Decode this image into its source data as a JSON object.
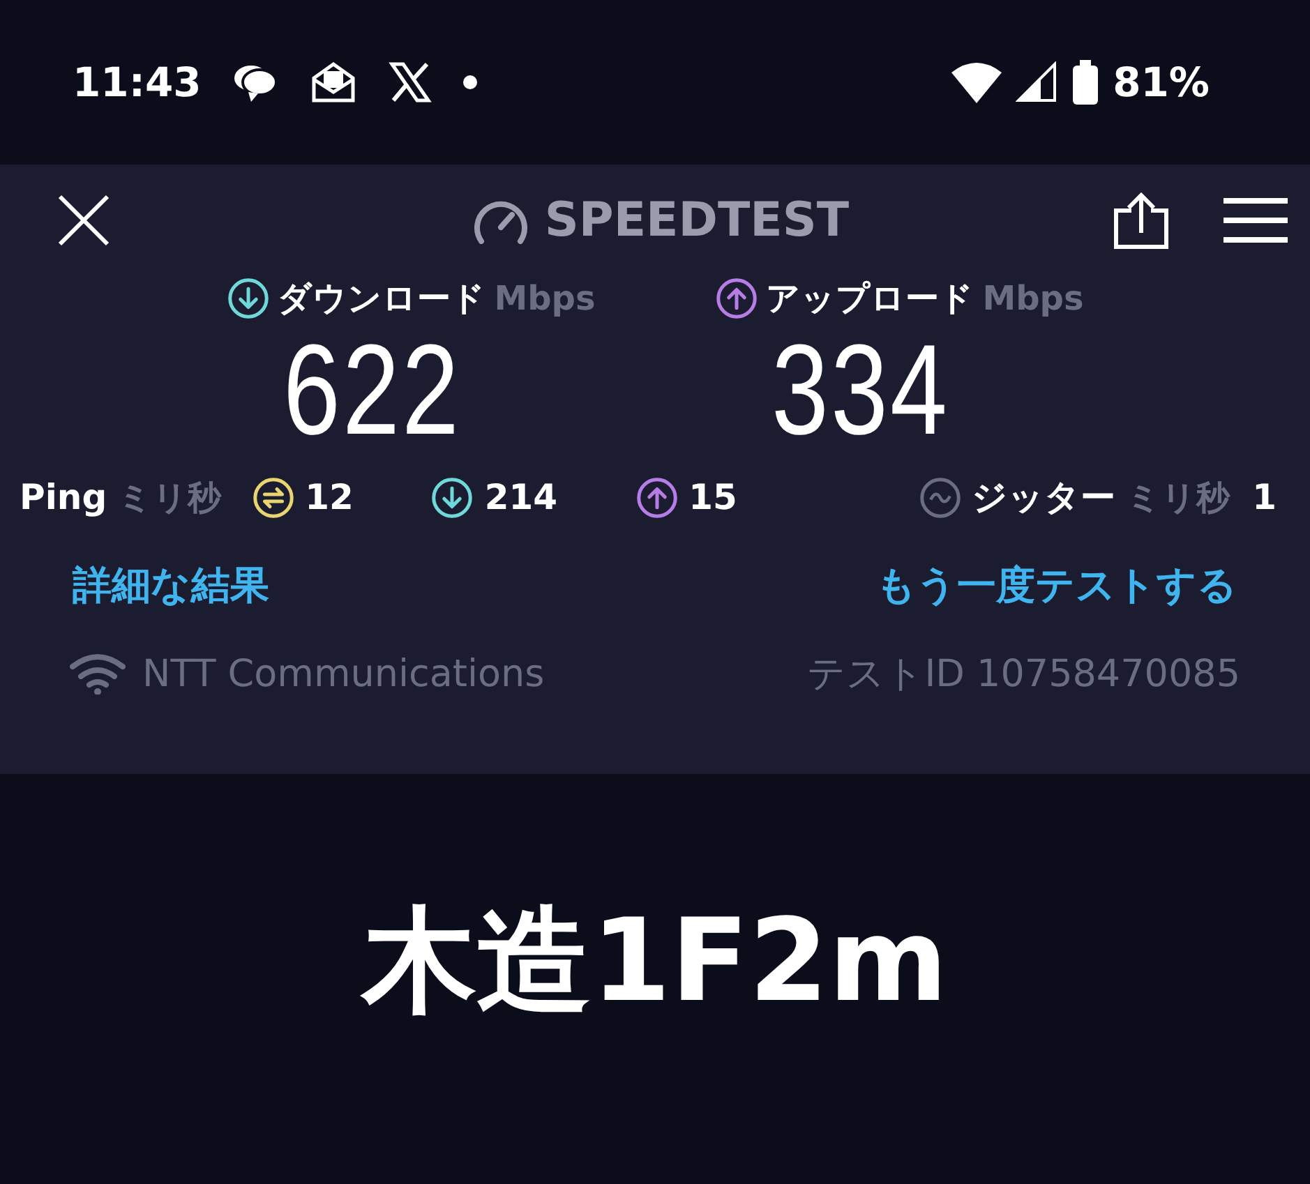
{
  "status_bar": {
    "time": "11:43",
    "battery": "81%"
  },
  "header": {
    "title": "SPEEDTEST"
  },
  "results": [
    {
      "kind": "download",
      "label": "ダウンロード",
      "unit": "Mbps",
      "value": "622"
    },
    {
      "kind": "upload",
      "label": "アップロード",
      "unit": "Mbps",
      "value": "334"
    }
  ],
  "ping": {
    "label": "Ping",
    "unit": "ミリ秒",
    "metrics": [
      {
        "kind": "ping",
        "value": "12"
      },
      {
        "kind": "download",
        "value": "214"
      },
      {
        "kind": "upload",
        "value": "15"
      }
    ]
  },
  "jitter": {
    "label": "ジッター",
    "unit": "ミリ秒",
    "value": "1"
  },
  "links": [
    "詳細な結果",
    "もう一度テストする"
  ],
  "provider": "NTT Communications",
  "test_id": "テストID 10758470085",
  "caption": "木造1F2m"
}
